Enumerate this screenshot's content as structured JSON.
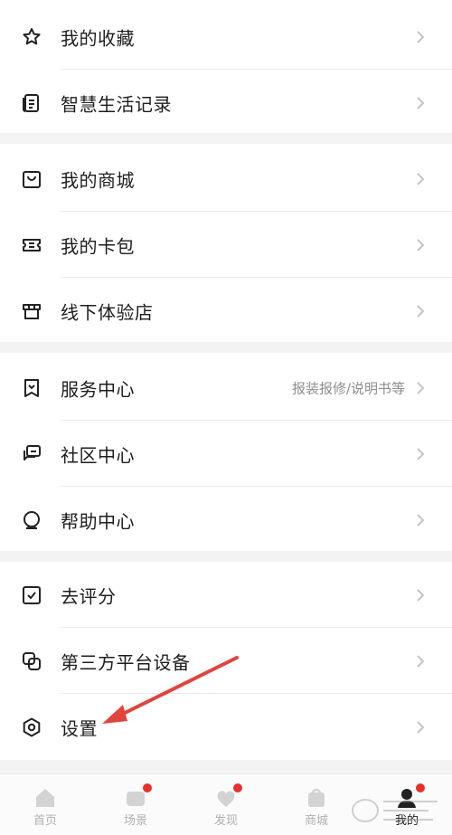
{
  "menu": {
    "favorites": {
      "label": "我的收藏",
      "icon": "star-icon"
    },
    "smart_life_record": {
      "label": "智慧生活记录",
      "icon": "document-icon"
    },
    "mall": {
      "label": "我的商城",
      "icon": "shopping-bag-icon"
    },
    "card_wallet": {
      "label": "我的卡包",
      "icon": "ticket-icon"
    },
    "offline_store": {
      "label": "线下体验店",
      "icon": "store-icon"
    },
    "service_center": {
      "label": "服务中心",
      "hint": "报装报修/说明书等",
      "icon": "bookmark-icon"
    },
    "community": {
      "label": "社区中心",
      "icon": "chat-bubbles-icon"
    },
    "help_center": {
      "label": "帮助中心",
      "icon": "help-robot-icon"
    },
    "rate": {
      "label": "去评分",
      "icon": "checkbox-icon"
    },
    "third_party_devices": {
      "label": "第三方平台设备",
      "icon": "linked-squares-icon"
    },
    "settings": {
      "label": "设置",
      "icon": "hexagon-settings-icon"
    }
  },
  "bottom_nav": {
    "home": {
      "label": "首页",
      "icon": "home-icon"
    },
    "scenes": {
      "label": "场景",
      "icon": "scene-icon",
      "badge": true
    },
    "discover": {
      "label": "发现",
      "icon": "discover-icon",
      "badge": true
    },
    "mall": {
      "label": "商城",
      "icon": "bag-icon"
    },
    "mine": {
      "label": "我的",
      "icon": "user-avatar-icon",
      "badge": true,
      "active": true
    }
  },
  "colors": {
    "badge": "#e8302c",
    "annotation_arrow": "#e0443e",
    "chevron": "#c4c4c4",
    "hint_text": "#8e8e8e"
  }
}
